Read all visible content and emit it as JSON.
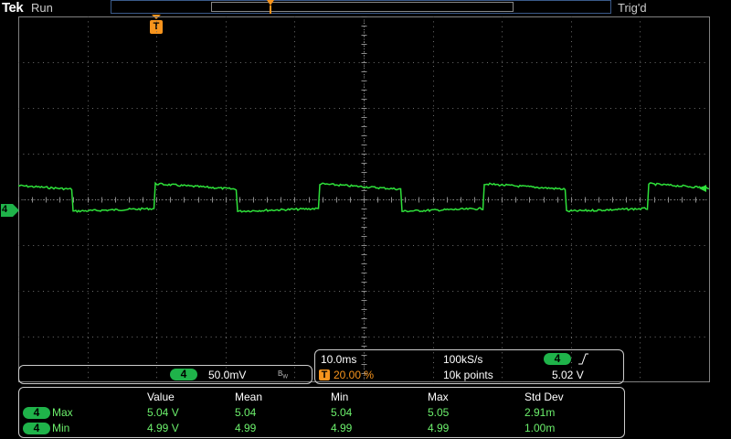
{
  "header": {
    "brand": "Tek",
    "run_state": "Run",
    "trigger_state": "Trig'd"
  },
  "channel": {
    "number": "4",
    "scale": "50.0mV",
    "bw_icon": "bw-limit-icon",
    "color": "#2ee03a"
  },
  "timebase": {
    "time_per_div": "10.0ms",
    "sample_rate": "100kS/s",
    "trigger_position": "20.00 %",
    "record_length": "10k points",
    "trigger_channel": "4",
    "trigger_slope_icon": "rising-edge-icon",
    "trigger_level": "5.02 V",
    "trigger_marker": "T"
  },
  "measurements": {
    "headers": [
      "Value",
      "Mean",
      "Min",
      "Max",
      "Std Dev"
    ],
    "rows": [
      {
        "channel": "4",
        "name": "Max",
        "values": [
          "5.04 V",
          "5.04",
          "5.04",
          "5.05",
          "2.91m"
        ]
      },
      {
        "channel": "4",
        "name": "Min",
        "values": [
          "4.99 V",
          "4.99",
          "4.99",
          "4.99",
          "1.00m"
        ]
      }
    ]
  },
  "colors": {
    "trace": "#2ee03a",
    "trigger": "#f7941d",
    "grid": "#808080"
  }
}
